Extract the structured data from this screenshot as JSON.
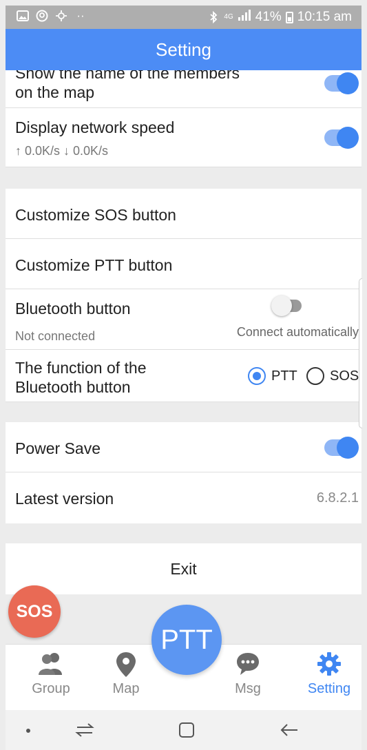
{
  "status_bar": {
    "network": "4G",
    "battery": "41%",
    "time": "10:15 am",
    "icons": [
      "gallery-icon",
      "assistant-icon",
      "sunlight-icon",
      "more-icon",
      "bluetooth-icon",
      "signal-icon",
      "battery-icon"
    ]
  },
  "header": {
    "title": "Setting"
  },
  "settings": {
    "show_names": {
      "label_line1": "Show the name of the members",
      "label_line2": "on the map",
      "enabled": true
    },
    "network_speed": {
      "label": "Display network speed",
      "sub": "↑ 0.0K/s ↓ 0.0K/s",
      "enabled": true
    },
    "customize_sos": {
      "label": "Customize SOS button"
    },
    "customize_ptt": {
      "label": "Customize PTT button"
    },
    "bluetooth": {
      "label": "Bluetooth button",
      "status": "Not connected",
      "auto_label": "Connect automatically",
      "enabled": false
    },
    "bt_function": {
      "label_line1": "The function of the",
      "label_line2": "Bluetooth button",
      "option_ptt": "PTT",
      "option_sos": "SOS",
      "selected": "PTT"
    },
    "power_save": {
      "label": "Power Save",
      "enabled": true
    },
    "latest_version": {
      "label": "Latest version",
      "value": "6.8.2.1"
    },
    "exit": {
      "label": "Exit"
    }
  },
  "floating": {
    "sos_label": "SOS",
    "ptt_label": "PTT"
  },
  "bottom_nav": [
    {
      "label": "Group",
      "icon": "group-icon",
      "active": false
    },
    {
      "label": "Map",
      "icon": "map-pin-icon",
      "active": false
    },
    {
      "label": "Msg",
      "icon": "chat-icon",
      "active": false
    },
    {
      "label": "Setting",
      "icon": "gear-icon",
      "active": true
    }
  ],
  "colors": {
    "accent": "#3f86f2",
    "header": "#4c8cf5",
    "sos": "#e96a55",
    "ptt": "#5c96f2"
  }
}
